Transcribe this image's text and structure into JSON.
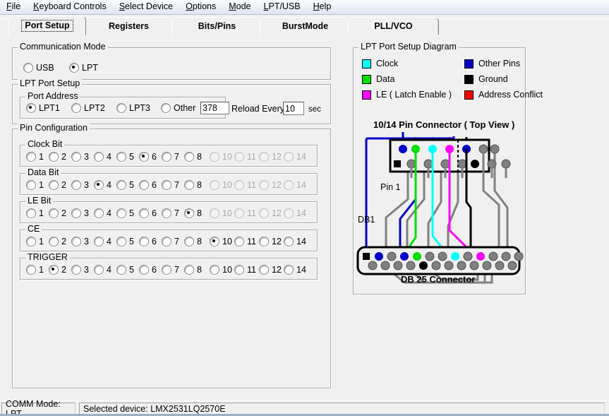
{
  "menu": {
    "items": [
      {
        "label": "File",
        "mnemonic": "F"
      },
      {
        "label": "Keyboard Controls",
        "mnemonic": "K"
      },
      {
        "label": "Select Device",
        "mnemonic": "S"
      },
      {
        "label": "Options",
        "mnemonic": "O"
      },
      {
        "label": "Mode",
        "mnemonic": "M"
      },
      {
        "label": "LPT/USB",
        "mnemonic": "L"
      },
      {
        "label": "Help",
        "mnemonic": "H"
      }
    ]
  },
  "tabs": [
    {
      "label": "Port Setup",
      "active": true
    },
    {
      "label": "Registers",
      "active": false
    },
    {
      "label": "Bits/Pins",
      "active": false
    },
    {
      "label": "BurstMode",
      "active": false
    },
    {
      "label": "PLL/VCO",
      "active": false
    }
  ],
  "comm_mode": {
    "title": "Communication Mode",
    "options": [
      {
        "label": "USB",
        "selected": false
      },
      {
        "label": "LPT",
        "selected": true
      }
    ]
  },
  "lpt_port_setup": {
    "title": "LPT Port Setup",
    "port_address": {
      "title": "Port Address",
      "options": [
        {
          "label": "LPT1",
          "selected": true
        },
        {
          "label": "LPT2",
          "selected": false
        },
        {
          "label": "LPT3",
          "selected": false
        },
        {
          "label": "Other",
          "selected": false
        }
      ],
      "other_value": "378"
    },
    "reload_label": "Reload Every",
    "reload_value": "10",
    "reload_unit": "sec"
  },
  "pin_configuration": {
    "title": "Pin Configuration",
    "pin_labels": [
      "1",
      "2",
      "3",
      "4",
      "5",
      "6",
      "7",
      "8",
      "10",
      "11",
      "12",
      "14"
    ],
    "rows": [
      {
        "title": "Clock Bit",
        "selected": "6",
        "disabled": [
          "10",
          "11",
          "12",
          "14"
        ]
      },
      {
        "title": "Data Bit",
        "selected": "4",
        "disabled": [
          "10",
          "11",
          "12",
          "14"
        ]
      },
      {
        "title": "LE Bit",
        "selected": "8",
        "disabled": [
          "10",
          "11",
          "12",
          "14"
        ]
      },
      {
        "title": "CE",
        "selected": "10",
        "disabled": []
      },
      {
        "title": "TRIGGER",
        "selected": "2",
        "disabled": []
      }
    ]
  },
  "diagram": {
    "title": "LPT Port Setup Diagram",
    "legend": [
      {
        "label": "Clock",
        "color": "#00ffff"
      },
      {
        "label": "Data",
        "color": "#00e000"
      },
      {
        "label": "LE ( Latch Enable )",
        "color": "#ff00ff"
      },
      {
        "label": "Other Pins",
        "color": "#0000cc"
      },
      {
        "label": "Ground",
        "color": "#000000"
      },
      {
        "label": "Address Conflict",
        "color": "#ff0000"
      }
    ],
    "connector_title": "10/14 Pin Connector ( Top View )",
    "pin1_label": "Pin 1",
    "db1_label": "DB1",
    "db25_label": "DB 25 Connector",
    "colors": {
      "clock": "#00ffff",
      "data": "#00e000",
      "le": "#ff00ff",
      "other": "#0000cc",
      "ground": "#000000",
      "conflict": "#ff0000",
      "unused_pin": "#808080",
      "wire_gray": "#808080"
    },
    "header_pins_top": [
      "other",
      "data",
      "clock",
      "le",
      "other",
      "gray",
      "gray"
    ],
    "header_pins_bottom": [
      "square",
      "gray",
      "gray",
      "gray",
      "gray",
      "ground",
      "gray",
      "gray"
    ],
    "db25_pins_top": [
      "square",
      "other",
      "gray",
      "other",
      "data",
      "gray",
      "gray",
      "clock",
      "gray",
      "le",
      "gray",
      "gray",
      "gray"
    ],
    "db25_pins_bottom": [
      "gray",
      "gray",
      "gray",
      "gray",
      "ground",
      "gray",
      "gray",
      "gray",
      "gray",
      "gray",
      "gray",
      "gray"
    ]
  },
  "statusbar": {
    "comm_mode": "COMM Mode: LPT",
    "selected_device": "Selected device: LMX2531LQ2570E"
  }
}
